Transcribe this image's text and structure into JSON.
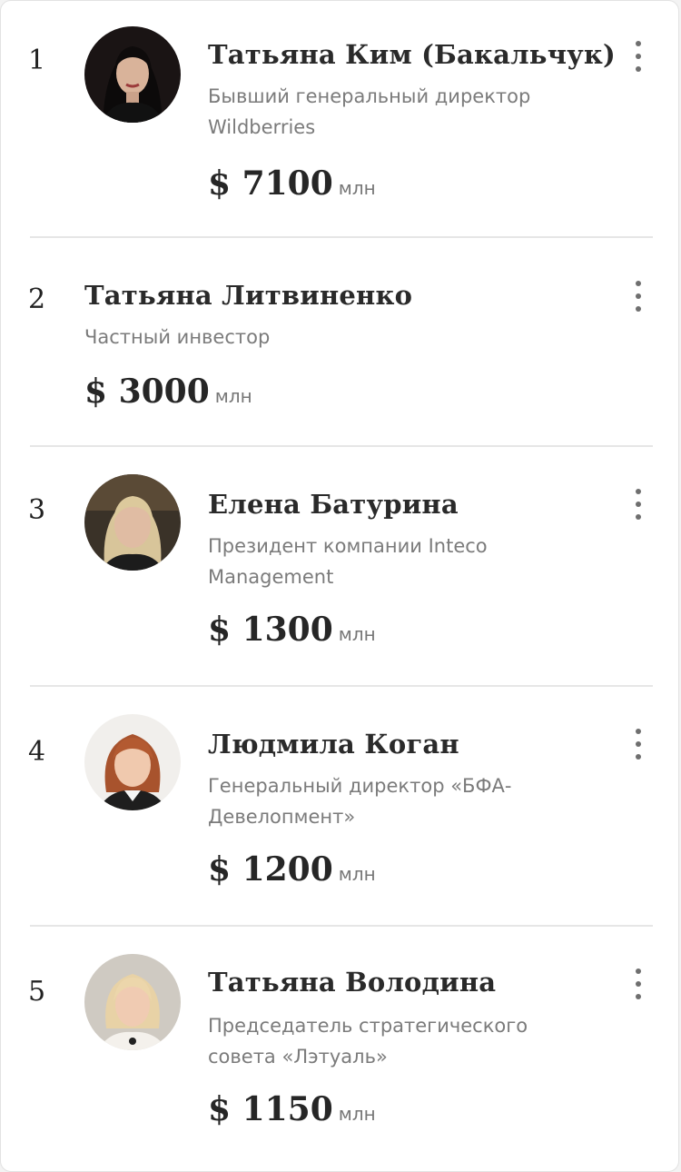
{
  "colors": {
    "background": "#ffffff",
    "name": "#2a2a2a",
    "description": "#7b7b7b",
    "divider": "#e6e6e6",
    "menu_dots": "#6f6f6f"
  },
  "entries": [
    {
      "rank": "1",
      "name": "Татьяна Ким (Бакальчук)",
      "description_lines": [
        "Бывший генеральный директор",
        "Wildberries"
      ],
      "amount": "$ 7100",
      "unit": "млн",
      "avatar": "photo-woman-dark-hair"
    },
    {
      "rank": "2",
      "name": "Татьяна Литвиненко",
      "description_lines": [
        "Частный инвестор"
      ],
      "amount": "$ 3000",
      "unit": "млн",
      "avatar": ""
    },
    {
      "rank": "3",
      "name": "Елена Батурина",
      "description_lines": [
        "Президент компании Inteco",
        "Management"
      ],
      "amount": "$ 1300",
      "unit": "млн",
      "avatar": "photo-woman-blonde"
    },
    {
      "rank": "4",
      "name": "Людмила Коган",
      "description_lines": [
        "Генеральный директор «БФА-",
        "Девелопмент»"
      ],
      "amount": "$ 1200",
      "unit": "млн",
      "avatar": "photo-woman-red-hair"
    },
    {
      "rank": "5",
      "name": "Татьяна Володина",
      "description_lines": [
        "Председатель стратегического",
        "совета «Лэтуаль»"
      ],
      "amount": "$ 1150",
      "unit": "млн",
      "avatar": "photo-woman-light-blonde"
    }
  ]
}
